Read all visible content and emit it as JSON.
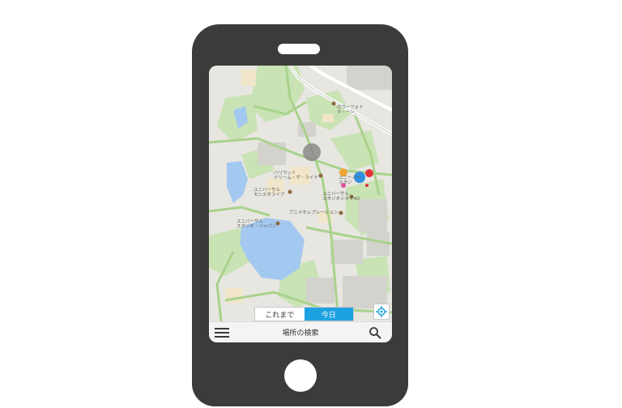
{
  "map": {
    "poi_labels": [
      "のりーフォト\nタ・ーン",
      "ハリウット\nドリーム・ザ・ライド",
      "ユニーバー\nスタジ",
      "ユニバーサル\nモンスタライブ",
      "ユニバーサル\nスタジオシネマ4D",
      "アニメセレブレーション",
      "ユニバーサル\nスタジオ・ジャパン"
    ]
  },
  "toggle": {
    "past_label": "これまで",
    "today_label": "今日",
    "active": "today",
    "active_color": "#1ea1e0"
  },
  "bottom_bar": {
    "search_label": "場所の検索"
  },
  "colors": {
    "device_body": "#3d3b39",
    "water": "#a4c9f0",
    "greenery": "#c9e3b5",
    "road": "#ffffff"
  },
  "icons": [
    "menu-icon",
    "search-icon",
    "locate-icon",
    "camera-icon"
  ]
}
